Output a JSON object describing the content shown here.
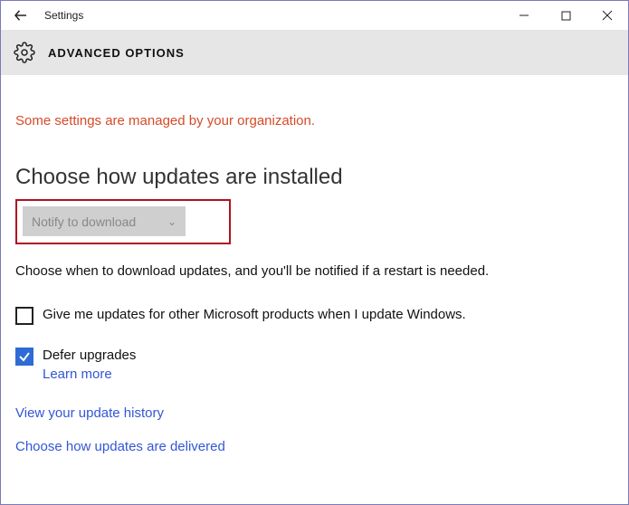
{
  "titlebar": {
    "title": "Settings"
  },
  "header": {
    "title": "ADVANCED OPTIONS"
  },
  "content": {
    "managed_message": "Some settings are managed by your organization.",
    "section_heading": "Choose how updates are installed",
    "dropdown": {
      "selected": "Notify to download"
    },
    "description": "Choose when to download updates, and you'll be notified if a restart is needed.",
    "checkbox_other_products": {
      "label": "Give me updates for other Microsoft products when I update Windows.",
      "checked": false
    },
    "checkbox_defer": {
      "label": "Defer upgrades",
      "checked": true,
      "learn_more": "Learn more"
    },
    "links": {
      "history": "View your update history",
      "delivery": "Choose how updates are delivered"
    }
  }
}
